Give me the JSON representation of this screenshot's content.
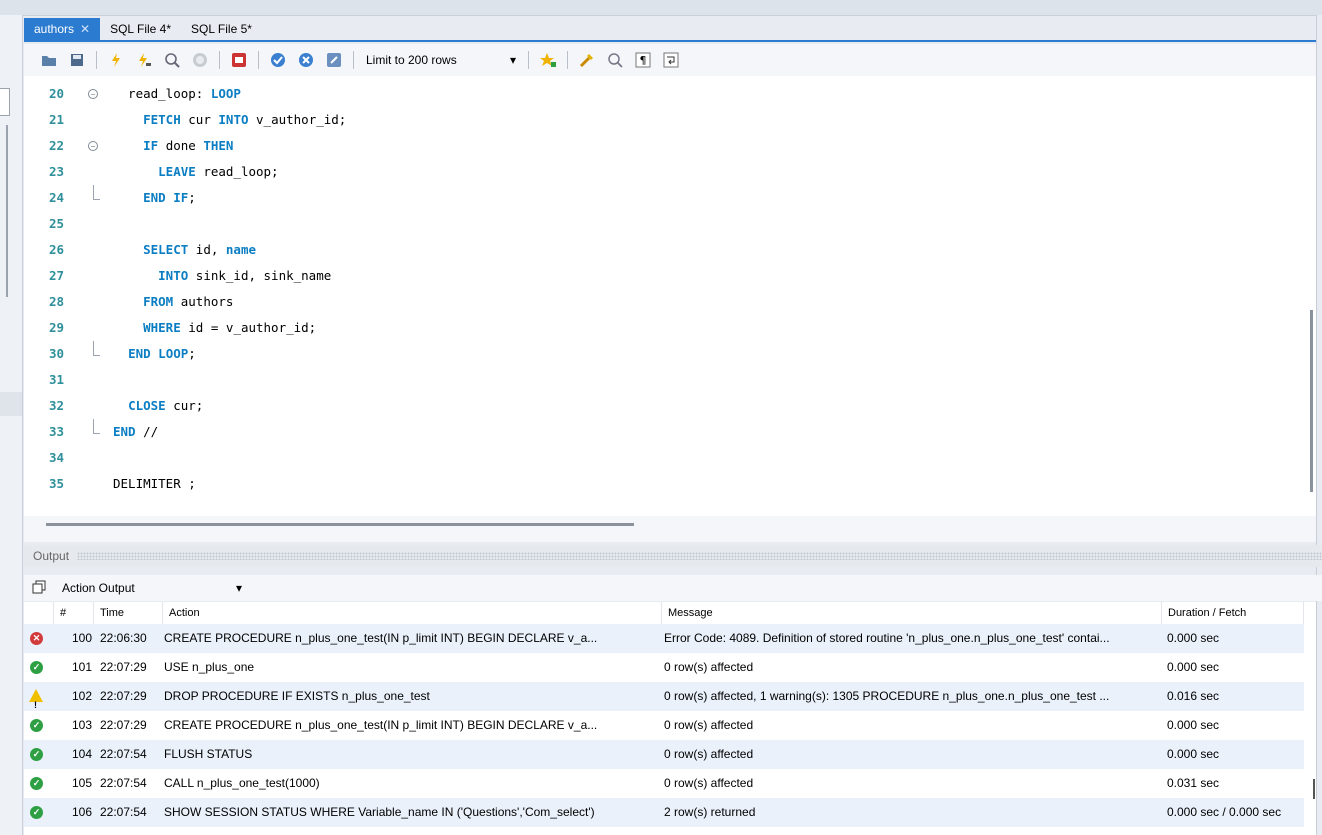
{
  "tabs": [
    {
      "label": "authors",
      "active": true
    },
    {
      "label": "SQL File 4*",
      "active": false
    },
    {
      "label": "SQL File 5*",
      "active": false
    }
  ],
  "toolbar": {
    "icons": [
      "open-folder-icon",
      "save-icon",
      "execute-icon",
      "execute-current-icon",
      "explain-icon",
      "stop-icon",
      "toggle-error-icon",
      "commit-icon",
      "rollback-icon",
      "autocommit-icon",
      "beautify-icon",
      "find-icon",
      "invisibles-icon",
      "wrap-icon",
      "add-snippet-icon"
    ],
    "limit_label": "Limit to 200 rows"
  },
  "editor": {
    "lines": [
      {
        "num": "20",
        "tokens": [
          {
            "t": "  read_loop: ",
            "k": false
          },
          {
            "t": "LOOP",
            "k": true
          }
        ]
      },
      {
        "num": "21",
        "tokens": [
          {
            "t": "    ",
            "k": false
          },
          {
            "t": "FETCH",
            "k": true
          },
          {
            "t": " cur ",
            "k": false
          },
          {
            "t": "INTO",
            "k": true
          },
          {
            "t": " v_author_id;",
            "k": false
          }
        ]
      },
      {
        "num": "22",
        "tokens": [
          {
            "t": "    ",
            "k": false
          },
          {
            "t": "IF",
            "k": true
          },
          {
            "t": " done ",
            "k": false
          },
          {
            "t": "THEN",
            "k": true
          }
        ]
      },
      {
        "num": "23",
        "tokens": [
          {
            "t": "      ",
            "k": false
          },
          {
            "t": "LEAVE",
            "k": true
          },
          {
            "t": " read_loop;",
            "k": false
          }
        ]
      },
      {
        "num": "24",
        "tokens": [
          {
            "t": "    ",
            "k": false
          },
          {
            "t": "END IF",
            "k": true
          },
          {
            "t": ";",
            "k": false
          }
        ]
      },
      {
        "num": "25",
        "tokens": []
      },
      {
        "num": "26",
        "tokens": [
          {
            "t": "    ",
            "k": false
          },
          {
            "t": "SELECT",
            "k": true
          },
          {
            "t": " id, ",
            "k": false
          },
          {
            "t": "name",
            "k": true
          }
        ]
      },
      {
        "num": "27",
        "tokens": [
          {
            "t": "      ",
            "k": false
          },
          {
            "t": "INTO",
            "k": true
          },
          {
            "t": " sink_id, sink_name",
            "k": false
          }
        ]
      },
      {
        "num": "28",
        "tokens": [
          {
            "t": "    ",
            "k": false
          },
          {
            "t": "FROM",
            "k": true
          },
          {
            "t": " authors",
            "k": false
          }
        ]
      },
      {
        "num": "29",
        "tokens": [
          {
            "t": "    ",
            "k": false
          },
          {
            "t": "WHERE",
            "k": true
          },
          {
            "t": " id = v_author_id;",
            "k": false
          }
        ]
      },
      {
        "num": "30",
        "tokens": [
          {
            "t": "  ",
            "k": false
          },
          {
            "t": "END LOOP",
            "k": true
          },
          {
            "t": ";",
            "k": false
          }
        ]
      },
      {
        "num": "31",
        "tokens": []
      },
      {
        "num": "32",
        "tokens": [
          {
            "t": "  ",
            "k": false
          },
          {
            "t": "CLOSE",
            "k": true
          },
          {
            "t": " cur;",
            "k": false
          }
        ]
      },
      {
        "num": "33",
        "tokens": [
          {
            "t": "END",
            "k": true
          },
          {
            "t": " //",
            "k": false
          }
        ]
      },
      {
        "num": "34",
        "tokens": []
      },
      {
        "num": "35",
        "tokens": [
          {
            "t": "DELIMITER ;",
            "k": false
          }
        ]
      }
    ]
  },
  "output": {
    "title": "Output",
    "selector": "Action Output",
    "columns": [
      "#",
      "Time",
      "Action",
      "Message",
      "Duration / Fetch"
    ],
    "rows": [
      {
        "status": "error",
        "num": "100",
        "time": "22:06:30",
        "action": "CREATE PROCEDURE n_plus_one_test(IN p_limit INT) BEGIN   DECLARE v_a...",
        "message": "Error Code: 4089. Definition of stored routine 'n_plus_one.n_plus_one_test' contai...",
        "duration": "0.000 sec"
      },
      {
        "status": "ok",
        "num": "101",
        "time": "22:07:29",
        "action": "USE n_plus_one",
        "message": "0 row(s) affected",
        "duration": "0.000 sec"
      },
      {
        "status": "warn",
        "num": "102",
        "time": "22:07:29",
        "action": "DROP PROCEDURE IF EXISTS n_plus_one_test",
        "message": "0 row(s) affected, 1 warning(s): 1305 PROCEDURE n_plus_one.n_plus_one_test ...",
        "duration": "0.016 sec"
      },
      {
        "status": "ok",
        "num": "103",
        "time": "22:07:29",
        "action": "CREATE PROCEDURE n_plus_one_test(IN p_limit INT) BEGIN   DECLARE v_a...",
        "message": "0 row(s) affected",
        "duration": "0.000 sec"
      },
      {
        "status": "ok",
        "num": "104",
        "time": "22:07:54",
        "action": "FLUSH STATUS",
        "message": "0 row(s) affected",
        "duration": "0.000 sec"
      },
      {
        "status": "ok",
        "num": "105",
        "time": "22:07:54",
        "action": "CALL n_plus_one_test(1000)",
        "message": "0 row(s) affected",
        "duration": "0.031 sec"
      },
      {
        "status": "ok",
        "num": "106",
        "time": "22:07:54",
        "action": "SHOW SESSION STATUS WHERE Variable_name IN ('Questions','Com_select')",
        "message": "2 row(s) returned",
        "duration": "0.000 sec / 0.000 sec"
      }
    ]
  }
}
